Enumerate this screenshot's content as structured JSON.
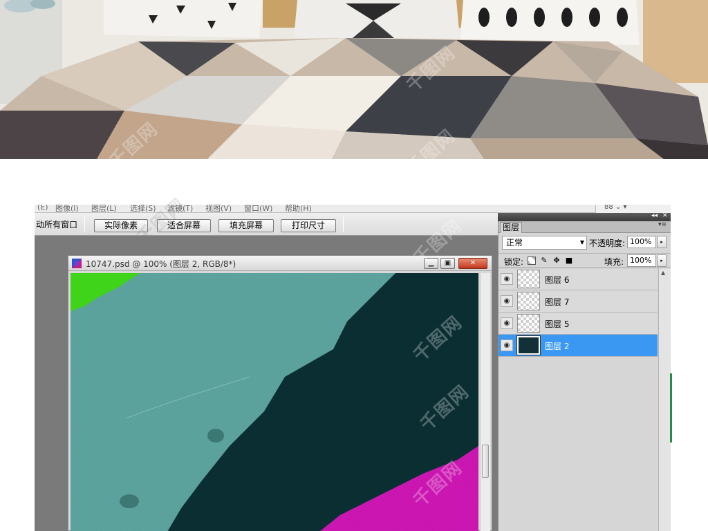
{
  "menubar": {
    "items": [
      "(E)",
      "图像(I)",
      "图层(L)",
      "选择(S)",
      "滤镜(T)",
      "视图(V)",
      "窗口(W)",
      "帮助(H)"
    ]
  },
  "options_bar": {
    "scroll_all_windows": "动所有窗口",
    "buttons": [
      "实际像素",
      "适合屏幕",
      "填充屏幕",
      "打印尺寸"
    ]
  },
  "document_window": {
    "title": "10747.psd @ 100% (图层 2, RGB/8*)",
    "min_glyph": "▁",
    "max_glyph": "▣",
    "close_glyph": "✕"
  },
  "canvas": {
    "colors": {
      "background": "#0b2e33",
      "teal_land": "#5fa8a3",
      "magenta": "#d316b8",
      "green": "#3fd31a"
    }
  },
  "top_icons": {
    "glyphs": "88 ⌄ ▾"
  },
  "panel_header": {
    "collapse_glyph": "◂◂",
    "close_glyph": "✕"
  },
  "layers_panel": {
    "tab_label": "图层",
    "tab_menu_glyph": "▾≡",
    "blend_mode": "正常",
    "opacity_label": "不透明度:",
    "opacity_value": "100%",
    "lock_label": "锁定:",
    "lock_icons": [
      "transparency-lock-icon",
      "brush-lock-icon",
      "move-lock-icon",
      "padlock-icon"
    ],
    "fill_label": "填充:",
    "fill_value": "100%",
    "stepper_glyph": "▸",
    "eye_glyph": "◉",
    "selected_color": "#3a98f2",
    "layers": [
      {
        "name": "图层 6",
        "selected": false
      },
      {
        "name": "图层 7",
        "selected": false
      },
      {
        "name": "图层 5",
        "selected": false
      },
      {
        "name": "图层 2",
        "selected": true
      }
    ]
  },
  "watermark": {
    "text": "千图网"
  }
}
